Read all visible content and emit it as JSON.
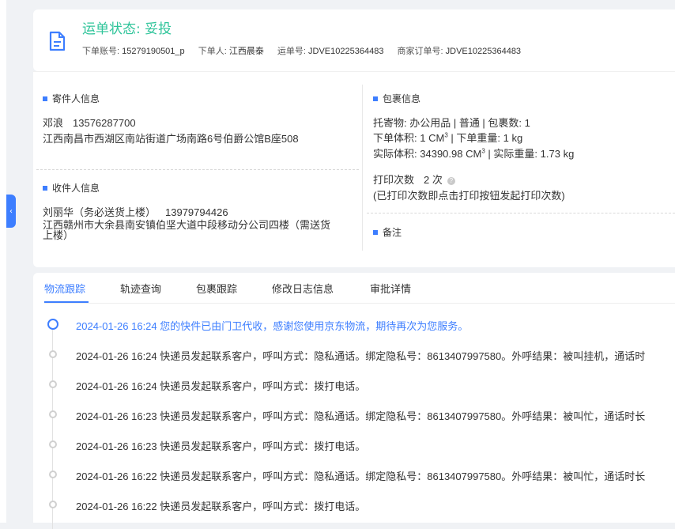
{
  "colors": {
    "accent": "#3d7eff",
    "status": "#2fc49a"
  },
  "header": {
    "status_title": "运单状态: 妥投",
    "order_account_label": "下单账号:",
    "order_account_value": "15279190501_p",
    "order_person_label": "下单人:",
    "order_person_value": "江西晨泰",
    "waybill_label": "运单号:",
    "waybill_value": "JDVE10225364483",
    "merchant_order_label": "商家订单号:",
    "merchant_order_value": "JDVE10225364483"
  },
  "sender": {
    "title": "寄件人信息",
    "name": "邓浪",
    "phone": "13576287700",
    "address": "江西南昌市西湖区南站街道广场南路6号伯爵公馆B座508"
  },
  "receiver": {
    "title": "收件人信息",
    "name": "刘丽华（务必送货上楼）",
    "phone": "13979794426",
    "address": "江西赣州市大余县南安镇伯坚大道中段移动分公司四楼（需送货上楼）"
  },
  "package": {
    "title": "包裹信息",
    "line1": "托寄物: 办公用品 | 普通 | 包裹数: 1",
    "volume_label": "下单体积:",
    "volume_value": "1 CM",
    "weight_label": "下单重量:",
    "weight_value": "1 kg",
    "actual_volume_label": "实际体积:",
    "actual_volume_value": "34390.98 CM",
    "actual_weight_label": "实际重量:",
    "actual_weight_value": "1.73 kg",
    "cube_superscript": "3",
    "separator": "|",
    "print_count_label": "打印次数",
    "print_count_value": "2 次",
    "print_hint": "(已打印次数即点击打印按钮发起打印次数)",
    "help_icon_glyph": "?"
  },
  "remark": {
    "title": "备注"
  },
  "tabs": [
    "物流跟踪",
    "轨迹查询",
    "包裹跟踪",
    "修改日志信息",
    "审批详情"
  ],
  "timeline": [
    "2024-01-26 16:24 您的快件已由门卫代收，感谢您使用京东物流，期待再次为您服务。",
    "2024-01-26 16:24 快递员发起联系客户，呼叫方式：隐私通话。绑定隐私号：8613407997580。外呼结果：被叫挂机，通话时",
    "2024-01-26 16:24 快递员发起联系客户，呼叫方式：拨打电话。",
    "2024-01-26 16:23 快递员发起联系客户，呼叫方式：隐私通话。绑定隐私号：8613407997580。外呼结果：被叫忙，通话时长",
    "2024-01-26 16:23 快递员发起联系客户，呼叫方式：拨打电话。",
    "2024-01-26 16:22 快递员发起联系客户，呼叫方式：隐私通话。绑定隐私号：8613407997580。外呼结果：被叫忙，通话时长",
    "2024-01-26 16:22 快递员发起联系客户，呼叫方式：拨打电话。"
  ]
}
